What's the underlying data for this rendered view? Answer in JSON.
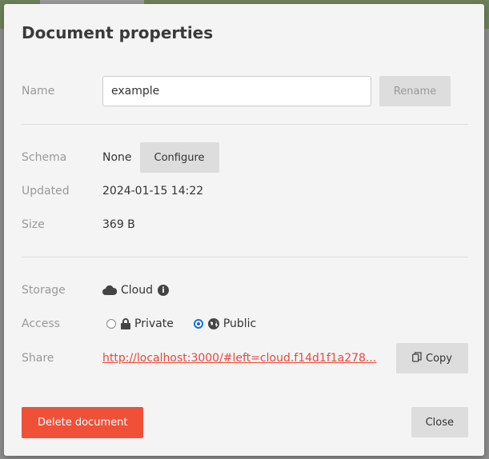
{
  "dialog": {
    "title": "Document properties"
  },
  "name": {
    "label": "Name",
    "value": "example",
    "rename": "Rename"
  },
  "schema": {
    "label": "Schema",
    "value": "None",
    "configure": "Configure"
  },
  "updated": {
    "label": "Updated",
    "value": "2024-01-15 14:22"
  },
  "size": {
    "label": "Size",
    "value": "369 B"
  },
  "storage": {
    "label": "Storage",
    "value": "Cloud",
    "icon": "cloud-icon"
  },
  "access": {
    "label": "Access",
    "options": [
      {
        "label": "Private",
        "icon": "lock-icon",
        "selected": false
      },
      {
        "label": "Public",
        "icon": "globe-icon",
        "selected": true
      }
    ]
  },
  "share": {
    "label": "Share",
    "link": "http://localhost:3000/#left=cloud.f14d1f1a278...",
    "copy": "Copy"
  },
  "footer": {
    "delete": "Delete document",
    "close": "Close"
  },
  "colors": {
    "danger": "#f05038",
    "accent": "#1a6fe0",
    "link": "#e8483a"
  }
}
